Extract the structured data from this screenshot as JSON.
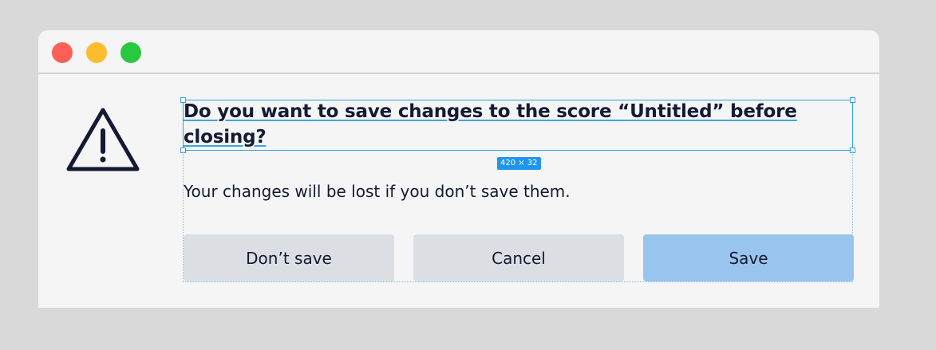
{
  "window": {
    "controls": {
      "close_color": "#fe5f57",
      "minimize_color": "#febc2e",
      "maximize_color": "#28c840"
    }
  },
  "dialog": {
    "icon": "warning-triangle-icon",
    "heading": "Do you want to save changes to the score “Untitled” before closing?",
    "heading_line1": "Do you want to save changes to the score “Untitled” before",
    "heading_line2": "closing?",
    "message": "Your changes will be lost if you don’t save them.",
    "size_badge": "420 × 32",
    "buttons": {
      "dont_save": "Don’t save",
      "cancel": "Cancel",
      "save": "Save"
    }
  },
  "colors": {
    "accent_selection": "#2ea3dc",
    "primary_button": "#99c4ee",
    "secondary_button": "#dbdfe3",
    "text": "#141a33"
  }
}
